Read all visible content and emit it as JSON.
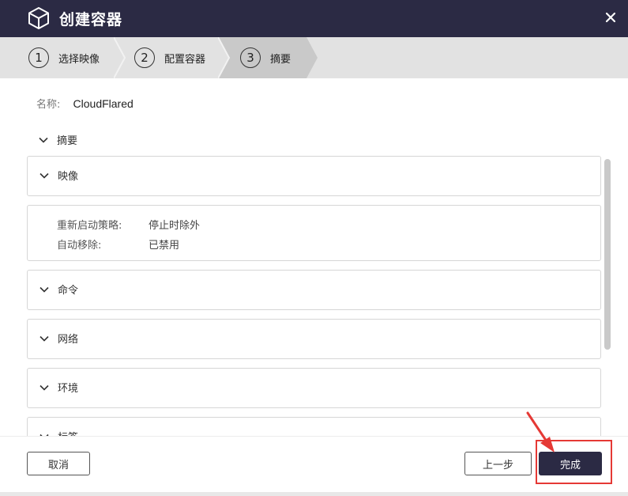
{
  "window": {
    "title": "创建容器"
  },
  "steps": [
    {
      "num": "1",
      "label": "选择映像"
    },
    {
      "num": "2",
      "label": "配置容器"
    },
    {
      "num": "3",
      "label": "摘要"
    }
  ],
  "name_field": {
    "label": "名称:",
    "value": "CloudFlared"
  },
  "summary": {
    "label": "摘要"
  },
  "panels": {
    "image": {
      "label": "映像"
    },
    "restart_policy": {
      "label": "重新启动策略:",
      "value": "停止时除外"
    },
    "auto_remove": {
      "label": "自动移除:",
      "value": "已禁用"
    },
    "command": {
      "label": "命令"
    },
    "network": {
      "label": "网络"
    },
    "environment": {
      "label": "环境"
    },
    "labels": {
      "label": "标签"
    }
  },
  "footer": {
    "cancel_label": "取消",
    "prev_label": "上一步",
    "finish_label": "完成"
  },
  "colors": {
    "header_bg": "#2b2a44",
    "highlight": "#e53935"
  }
}
